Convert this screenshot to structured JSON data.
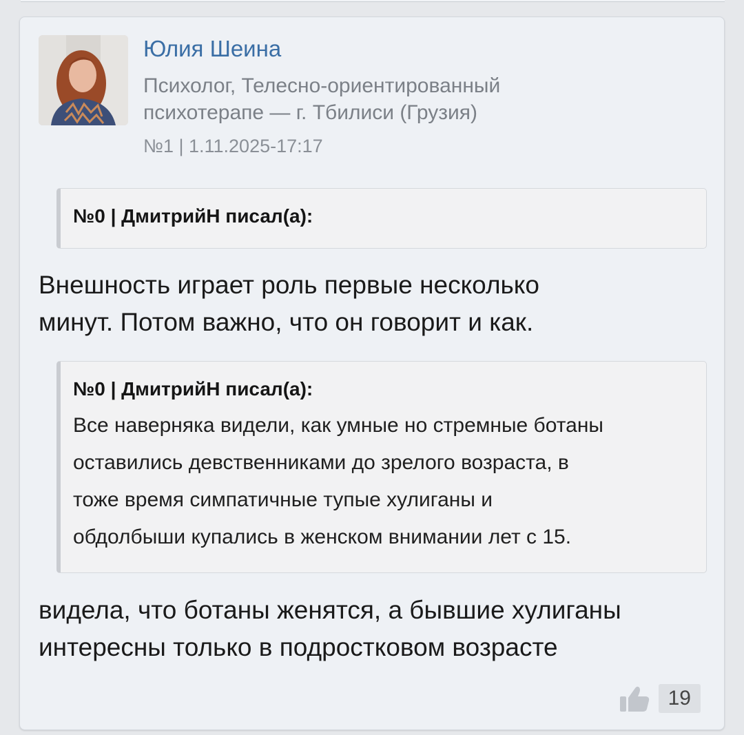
{
  "post": {
    "author": "Юлия Шеина",
    "role_line1": "Психолог, Телесно-ориентированный",
    "role_line2": "психотерапе — г. Тбилиси (Грузия)",
    "meta": "№1 | 1.11.2025-17:17",
    "quote1": {
      "header": "№0 | ДмитрийН писал(а):"
    },
    "message1_line1": "Внешность играет роль первые несколько",
    "message1_line2": "минут. Потом важно, что он говорит и как.",
    "quote2": {
      "header": "№0 | ДмитрийН писал(а):",
      "line1": "Все наверняка видели, как умные но стремные ботаны",
      "line2": "оставились девственниками до зрелого возраста, в",
      "line3": "тоже время симпатичные тупые хулиганы и",
      "line4": "обдолбыши купались в женском внимании лет с 15."
    },
    "message2_line1": "видела, что ботаны женятся, а бывшие хулиганы",
    "message2_line2": "интересны только в подростковом возрасте",
    "likes": "19"
  },
  "colors": {
    "author_link": "#3a6ea5",
    "card_bg": "#eef1f5",
    "page_bg": "#e6e8eb"
  },
  "icons": {
    "like": "thumbs-up-icon"
  }
}
